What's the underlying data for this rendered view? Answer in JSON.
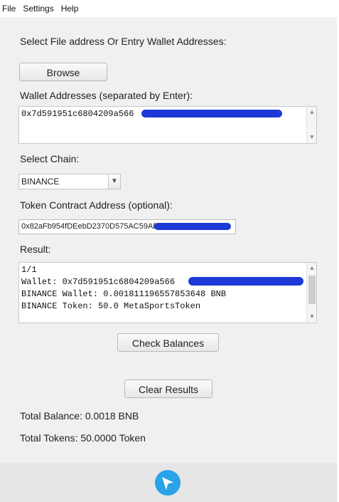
{
  "menu": [
    "File",
    "Settings",
    "Help"
  ],
  "select_file_label": "Select File address Or Entry Wallet Addresses:",
  "browse_label": "Browse",
  "wallet_label": "Wallet Addresses (separated by Enter):",
  "wallet_value": "0x7d591951c6804209a566",
  "chain_label": "Select Chain:",
  "chain_selected": "BINANCE",
  "token_label": "Token Contract Address (optional):",
  "token_value": "0x82aFb954fDEebD2370D575AC59AE",
  "result_label": "Result:",
  "result_lines": [
    "1/1",
    "Wallet: 0x7d591951c6804209a566",
    "BINANCE Wallet: 0.001811196557853648 BNB",
    "BINANCE Token: 50.0 MetaSportsToken"
  ],
  "check_label": "Check Balances",
  "clear_label": "Clear Results",
  "total_balance": "Total Balance: 0.0018 BNB",
  "total_tokens": "Total Tokens: 50.0000 Token",
  "icons": {
    "scroll_up": "▲",
    "scroll_down": "▼",
    "dropdown": "▼",
    "send": "send-icon"
  },
  "colors": {
    "redaction": "#1d3ad6",
    "send_button": "#2aa3e8"
  }
}
